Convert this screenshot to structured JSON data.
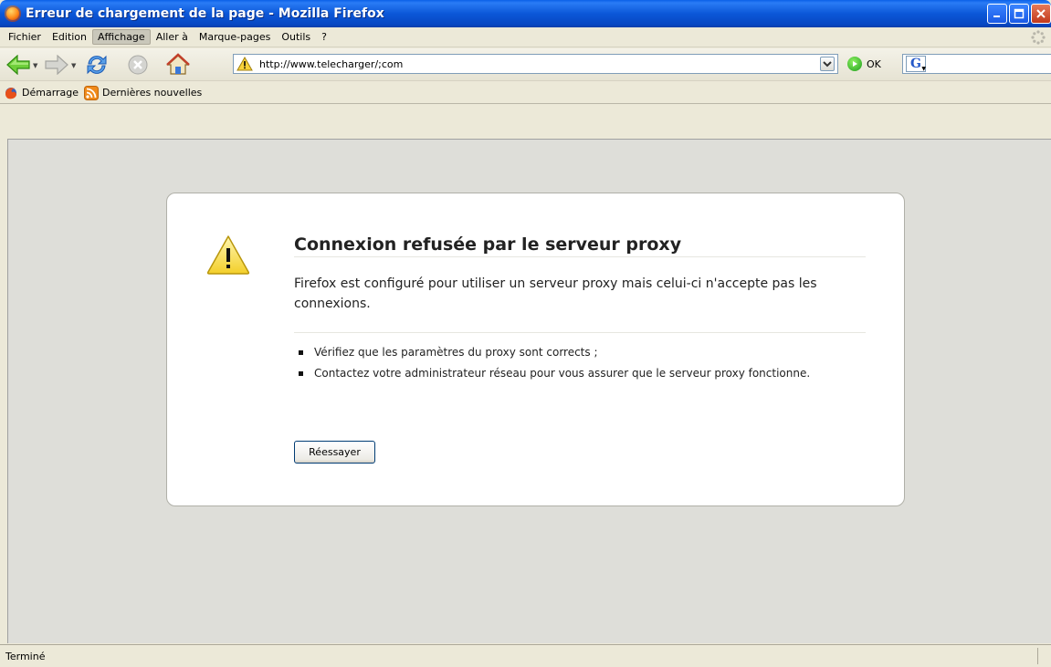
{
  "window": {
    "title": "Erreur de chargement de la page - Mozilla Firefox",
    "buttons": [
      "minimize",
      "maximize",
      "close"
    ]
  },
  "menubar": {
    "items": [
      {
        "label": "Fichier"
      },
      {
        "label": "Edition"
      },
      {
        "label": "Affichage",
        "active": true
      },
      {
        "label": "Aller à"
      },
      {
        "label": "Marque-pages"
      },
      {
        "label": "Outils"
      },
      {
        "label": "?"
      }
    ]
  },
  "navbar": {
    "url": "http://www.telecharger/;com",
    "go_label": "OK",
    "search_engine": "G",
    "icons": [
      "back-icon",
      "forward-icon",
      "reload-icon",
      "stop-icon",
      "home-icon",
      "warning-icon",
      "go-icon",
      "google-icon"
    ]
  },
  "bookmarks": {
    "items": [
      {
        "label": "Démarrage",
        "icon": "firefox-icon"
      },
      {
        "label": "Dernières nouvelles",
        "icon": "rss-icon"
      }
    ]
  },
  "error": {
    "title": "Connexion refusée par le serveur proxy",
    "description": "Firefox est configuré pour utiliser un serveur proxy mais celui-ci n'accepte pas les connexions.",
    "items": [
      "Vérifiez que les paramètres du proxy sont corrects ;",
      "Contactez votre administrateur réseau pour vous assurer que le serveur proxy fonctionne."
    ],
    "retry_label": "Réessayer"
  },
  "status": {
    "text": "Terminé"
  },
  "colors": {
    "titlebar": "#0a5fe8",
    "chrome": "#ece9d8",
    "content_bg": "#deded9",
    "warning": "#f5c518"
  }
}
